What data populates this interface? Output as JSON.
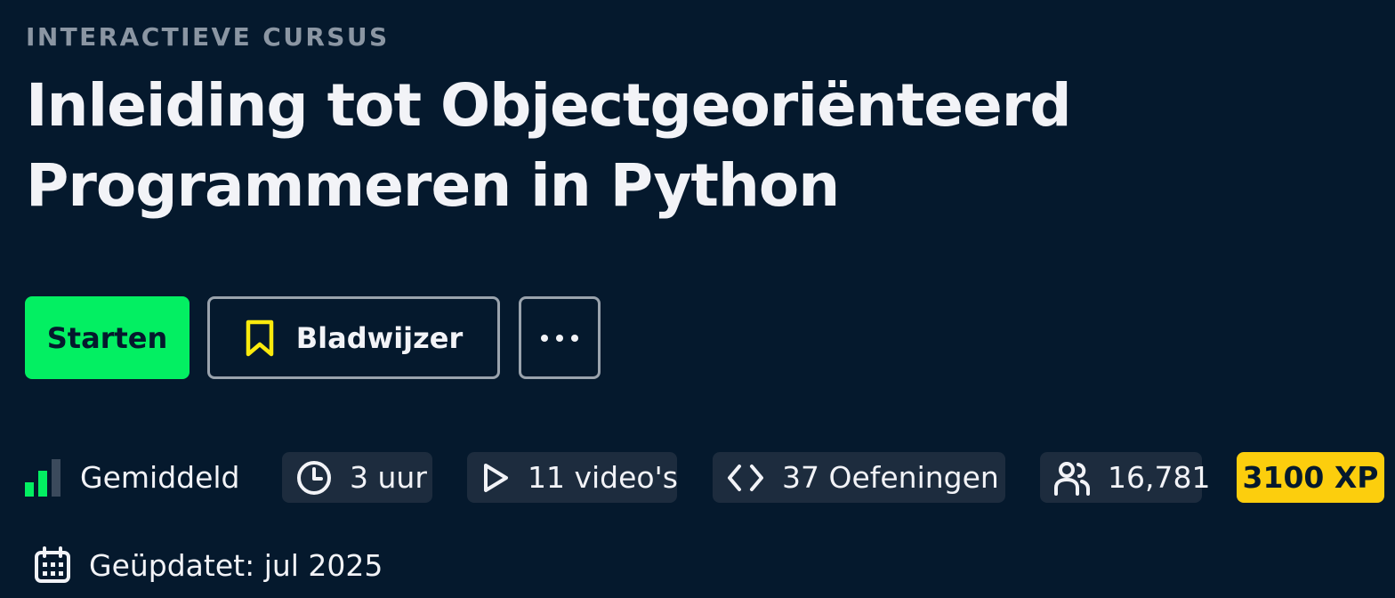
{
  "course": {
    "eyebrow": "INTERACTIEVE CURSUS",
    "title_line1": "Inleiding tot Objectgeoriënteerd",
    "title_line2": "Programmeren in Python"
  },
  "actions": {
    "start_label": "Starten",
    "bookmark_label": "Bladwijzer",
    "more_icon": "ellipsis-icon",
    "bookmark_icon": "bookmark-icon"
  },
  "stats": {
    "level": {
      "label": "Gemiddeld",
      "icon": "bar-chart-icon",
      "bars_filled": 2,
      "bars_total": 3
    },
    "duration": {
      "label": "3 uur",
      "icon": "clock-icon"
    },
    "videos": {
      "label": "11 video's",
      "icon": "play-icon"
    },
    "exercises": {
      "label": "37 Oefeningen",
      "icon": "code-icon"
    },
    "learners": {
      "label": "16,781",
      "icon": "users-icon"
    },
    "xp": {
      "label": "3100 XP"
    }
  },
  "updated": {
    "label": "Geüpdatet: jul 2025",
    "icon": "calendar-icon"
  },
  "colors": {
    "background": "#05192d",
    "primary": "#03ef62",
    "bookmark_icon": "#fcea0d",
    "xp_badge": "#fcce0d",
    "chip_background": "#1d2c3e",
    "eyebrow_text": "#8b96a3"
  }
}
